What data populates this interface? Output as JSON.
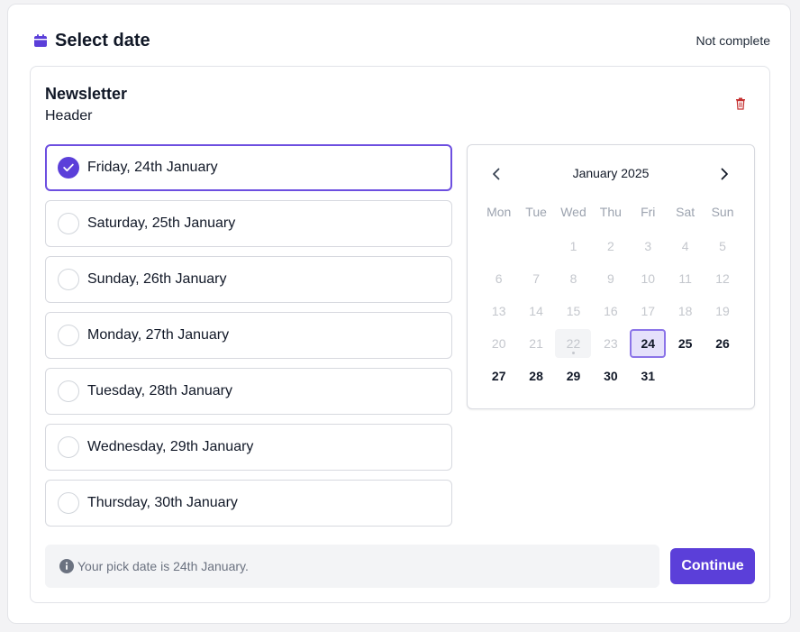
{
  "header": {
    "title": "Select date",
    "status": "Not complete",
    "icon": "calendar-icon"
  },
  "section": {
    "title": "Newsletter",
    "subtitle": "Header",
    "delete_icon": "trash-icon"
  },
  "options": [
    {
      "label": "Friday, 24th January",
      "selected": true
    },
    {
      "label": "Saturday, 25th January",
      "selected": false
    },
    {
      "label": "Sunday, 26th January",
      "selected": false
    },
    {
      "label": "Monday, 27th January",
      "selected": false
    },
    {
      "label": "Tuesday, 28th January",
      "selected": false
    },
    {
      "label": "Wednesday, 29th January",
      "selected": false
    },
    {
      "label": "Thursday, 30th January",
      "selected": false
    }
  ],
  "calendar": {
    "month": "January 2025",
    "weekdays": [
      "Mon",
      "Tue",
      "Wed",
      "Thu",
      "Fri",
      "Sat",
      "Sun"
    ],
    "weeks": [
      [
        "",
        "",
        "1",
        "2",
        "3",
        "4",
        "5"
      ],
      [
        "6",
        "7",
        "8",
        "9",
        "10",
        "11",
        "12"
      ],
      [
        "13",
        "14",
        "15",
        "16",
        "17",
        "18",
        "19"
      ],
      [
        "20",
        "21",
        "22",
        "23",
        "24",
        "25",
        "26"
      ],
      [
        "27",
        "28",
        "29",
        "30",
        "31",
        "",
        ""
      ]
    ],
    "today": "22",
    "selected": "24",
    "first_available": 24
  },
  "info": {
    "text": "Your pick date is 24th January.",
    "icon": "info-icon"
  },
  "actions": {
    "continue_label": "Continue"
  },
  "colors": {
    "accent": "#5b3fd9",
    "selected_border": "#6d4fe0",
    "selected_day_bg": "#e5e1fb",
    "danger": "#c53030"
  }
}
